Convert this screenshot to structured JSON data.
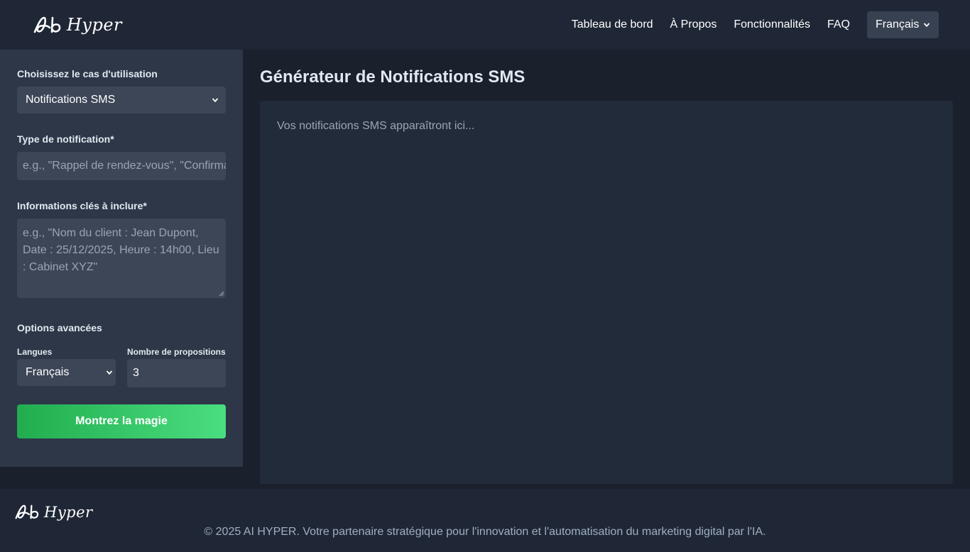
{
  "header": {
    "logo_text": "Hyper",
    "nav": [
      "Tableau de bord",
      "À Propos",
      "Fonctionnalités",
      "FAQ"
    ],
    "language": "Français"
  },
  "sidebar": {
    "use_case_label": "Choisissez le cas d'utilisation",
    "use_case_value": "Notifications SMS",
    "notification_type_label": "Type de notification*",
    "notification_type_placeholder": "e.g., \"Rappel de rendez-vous\", \"Confirmation de commande\"",
    "key_info_label": "Informations clés à inclure*",
    "key_info_placeholder": "e.g., \"Nom du client : Jean Dupont, Date : 25/12/2025, Heure : 14h00, Lieu : Cabinet XYZ\"",
    "advanced_label": "Options avancées",
    "languages_label": "Langues",
    "languages_value": "Français",
    "proposals_label": "Nombre de propositions",
    "proposals_value": "3",
    "submit_label": "Montrez la magie"
  },
  "main": {
    "title": "Générateur de Notifications SMS",
    "output_placeholder": "Vos notifications SMS apparaîtront ici..."
  },
  "footer": {
    "logo_text": "Hyper",
    "copyright": "© 2025 AI HYPER. Votre partenaire stratégique pour l'innovation et l'automatisation du marketing digital par l'IA."
  },
  "colors": {
    "background": "#1a202c",
    "header": "#1f2736",
    "sidebar": "#2d3748",
    "input": "#3c4657",
    "accent_start": "#21ad4e",
    "accent_end": "#4ade80"
  }
}
